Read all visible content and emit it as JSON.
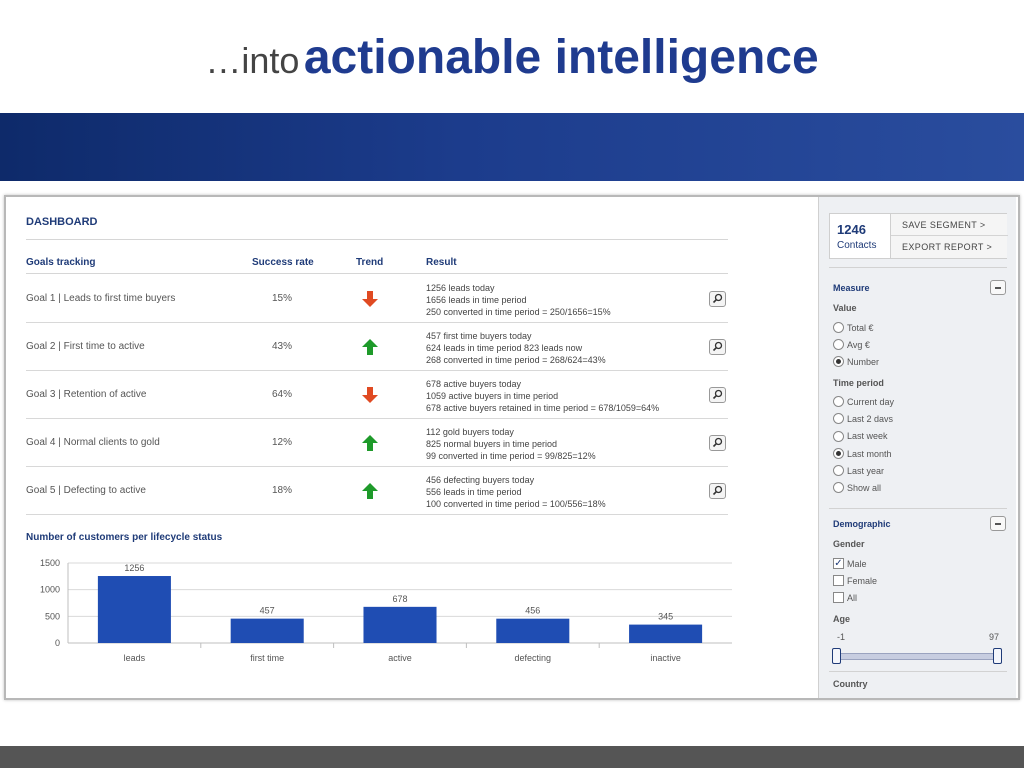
{
  "slide": {
    "title_pre": "…into",
    "title_main": "actionable intelligence"
  },
  "dashboard": {
    "title": "DASHBOARD",
    "columns": {
      "goals": "Goals tracking",
      "rate": "Success rate",
      "trend": "Trend",
      "result": "Result"
    },
    "goals": [
      {
        "label": "Goal 1  |  Leads to first time buyers",
        "rate": "15%",
        "trend": "down",
        "result": [
          "1256 leads today",
          "1656 leads in time period",
          "250 converted in time period = 250/1656=15%"
        ]
      },
      {
        "label": "Goal 2  |  First time to active",
        "rate": "43%",
        "trend": "up",
        "result": [
          "457 first time buyers today",
          "624 leads in time period 823 leads now",
          "268 converted in time period = 268/624=43%"
        ]
      },
      {
        "label": "Goal 3  |  Retention of active",
        "rate": "64%",
        "trend": "down",
        "result": [
          "678 active buyers today",
          "1059 active buyers in time period",
          "678 active buyers retained in time period = 678/1059=64%"
        ]
      },
      {
        "label": "Goal 4  |  Normal clients to gold",
        "rate": "12%",
        "trend": "up",
        "result": [
          "112 gold buyers today",
          "825 normal buyers in time period",
          "99 converted in time period = 99/825=12%"
        ]
      },
      {
        "label": "Goal 5  |  Defecting to active",
        "rate": "18%",
        "trend": "up",
        "result": [
          "456 defecting buyers today",
          "556 leads in time period",
          "100 converted in time period = 100/556=18%"
        ]
      }
    ],
    "colors": {
      "up": "#1e9a2a",
      "down": "#e04a22",
      "bar": "#1f4db3",
      "accent": "#1f3b78"
    },
    "chart_title": "Number of customers per lifecycle status"
  },
  "chart_data": {
    "type": "bar",
    "title": "Number of customers per lifecycle status",
    "categories": [
      "leads",
      "first time",
      "active",
      "defecting",
      "inactive"
    ],
    "values": [
      1256,
      457,
      678,
      456,
      345
    ],
    "data_labels": [
      "1256",
      "457",
      "678",
      "456",
      "345"
    ],
    "ylim": [
      0,
      1500
    ],
    "yticks": [
      0,
      500,
      1000,
      1500
    ],
    "grid": true,
    "xlabel": "",
    "ylabel": ""
  },
  "sidebar": {
    "contacts_count": "1246",
    "contacts_label": "Contacts",
    "save_segment": "SAVE SEGMENT  >",
    "export_report": "EXPORT REPORT >",
    "measure": {
      "title": "Measure",
      "value_label": "Value",
      "value_options": [
        "Total €",
        "Avg €",
        "Number"
      ],
      "value_selected": "Number",
      "period_label": "Time period",
      "period_options": [
        "Current day",
        "Last 2 davs",
        "Last week",
        "Last month",
        "Last year",
        "Show all"
      ],
      "period_selected": "Last month"
    },
    "demographic": {
      "title": "Demographic",
      "gender_label": "Gender",
      "gender_options": [
        "Male",
        "Female",
        "All"
      ],
      "gender_checked": [
        "Male"
      ],
      "age_label": "Age",
      "age_min": "-1",
      "age_max": "97",
      "country_label": "Country"
    }
  }
}
